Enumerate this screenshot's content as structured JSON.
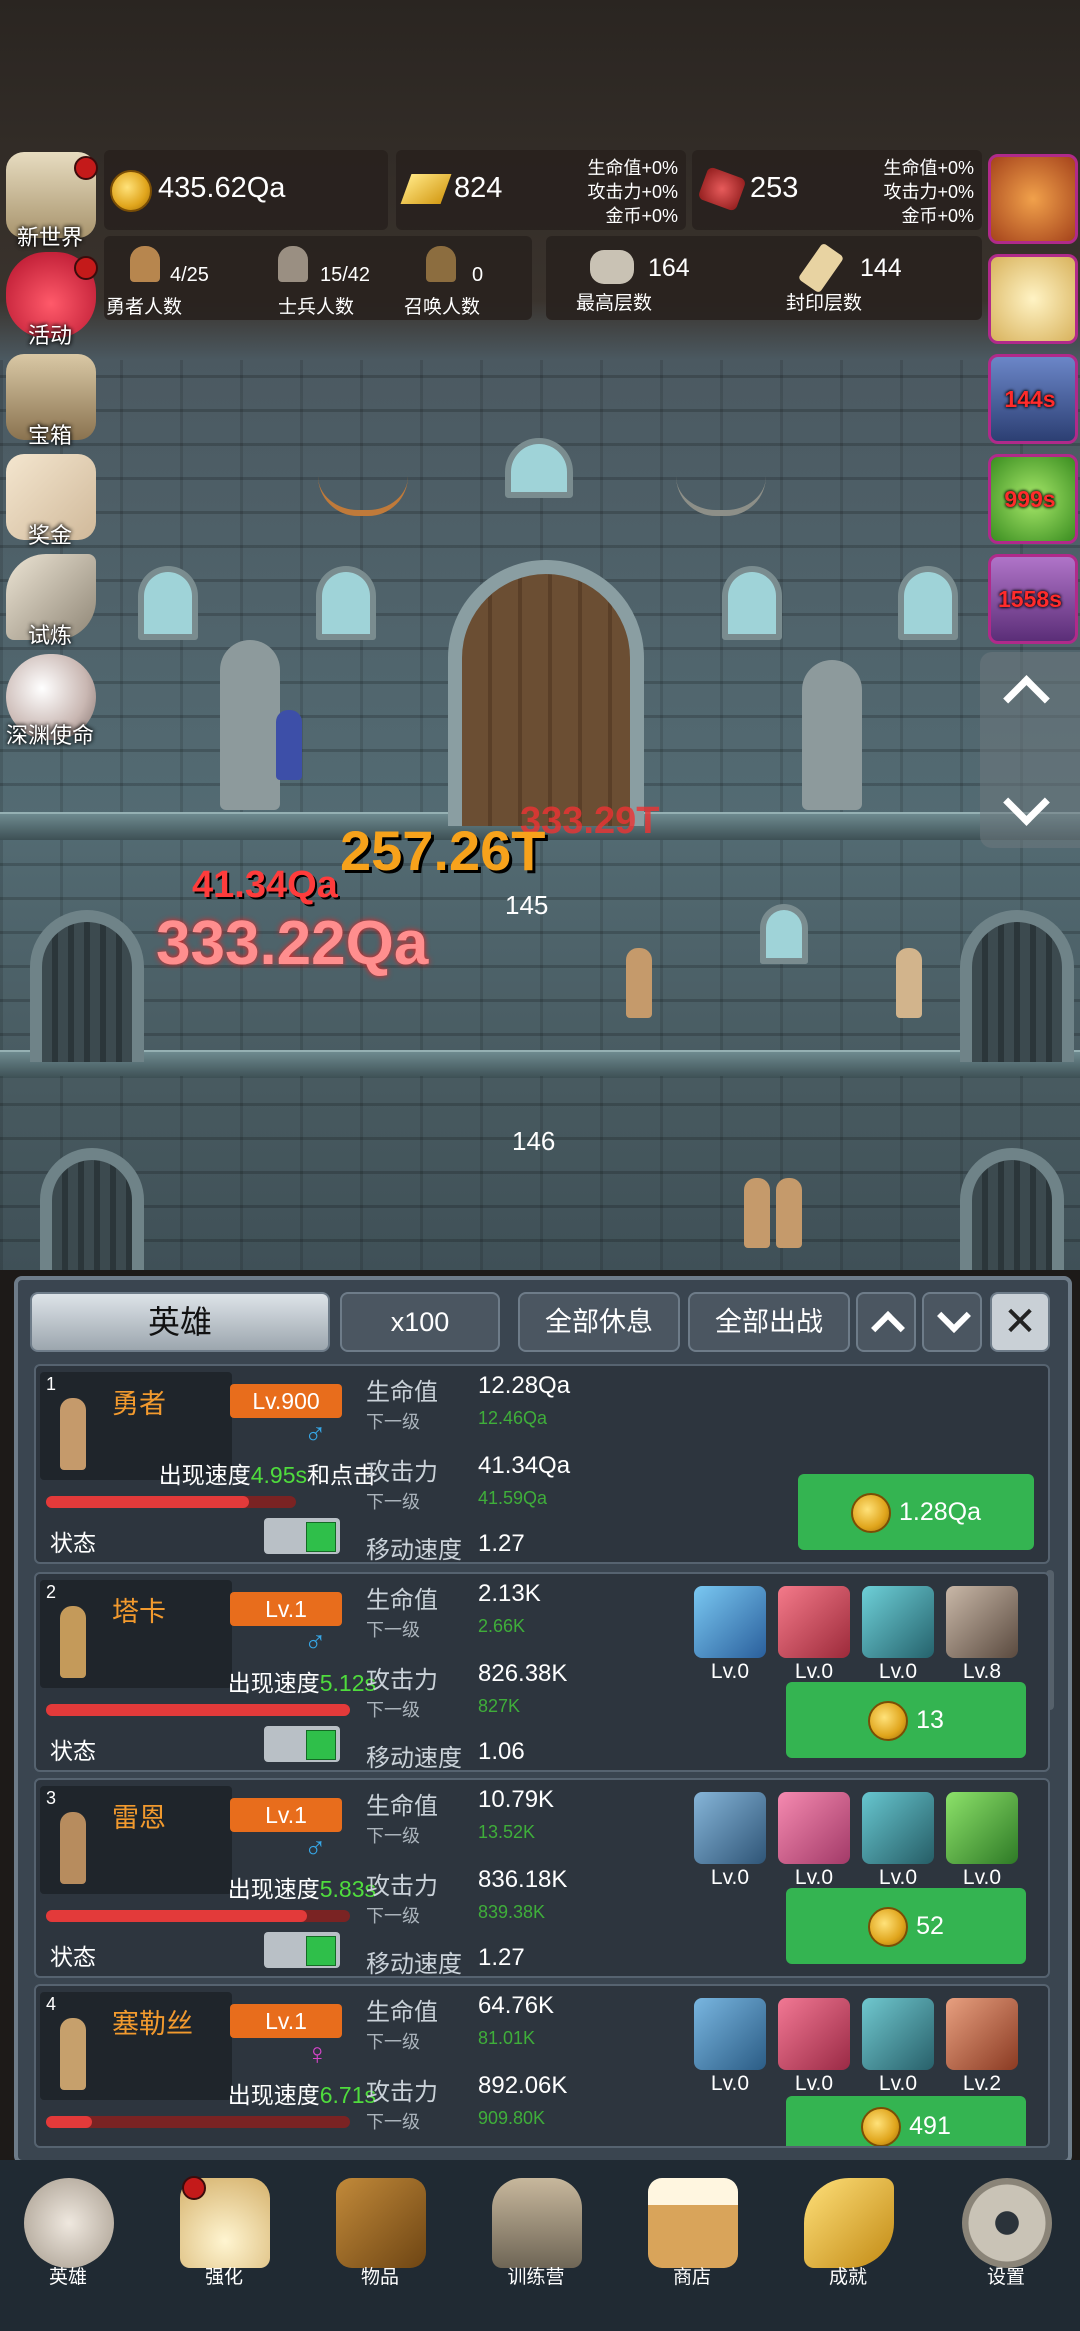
{
  "resources": {
    "gold": "435.62Qa",
    "gold_bar": "824",
    "gold_bar_bonus": [
      "生命值+0%",
      "攻击力+0%",
      "金币+0%"
    ],
    "gem": "253",
    "gem_bonus": [
      "生命值+0%",
      "攻击力+0%",
      "金币+0%"
    ]
  },
  "counts": {
    "heroes_value": "4/25",
    "heroes_label": "勇者人数",
    "soldiers_value": "15/42",
    "soldiers_label": "士兵人数",
    "summon_value": "0",
    "summon_label": "召唤人数",
    "max_floor_value": "164",
    "max_floor_label": "最高层数",
    "seal_floor_value": "144",
    "seal_floor_label": "封印层数"
  },
  "side_menu": [
    "新世界",
    "活动",
    "宝箱",
    "奖金",
    "试炼",
    "深渊使命"
  ],
  "right_timers": [
    "144s",
    "999s",
    "1558s"
  ],
  "scene": {
    "floor_a": "145",
    "floor_b": "146",
    "damage": [
      "257.26T",
      "41.34Qa",
      "333.22Qa",
      "333.29T"
    ]
  },
  "panel": {
    "tab_heroes": "英雄",
    "multiplier": "x100",
    "rest_all": "全部休息",
    "fight_all": "全部出战"
  },
  "heroes": [
    {
      "index": "1",
      "name": "勇者",
      "level": "Lv.900",
      "speed_prefix": "出现速度",
      "speed": "4.95s",
      "speed_suffix": "和点击",
      "hp_label": "生命值",
      "hp": "12.28Qa",
      "next_label": "下一级",
      "hp_next": "12.46Qa",
      "atk_label": "攻击力",
      "atk": "41.34Qa",
      "atk_next": "41.59Qa",
      "move_label": "移动速度",
      "move": "1.27",
      "status_label": "状态",
      "cost": "1.28Qa",
      "hp_ratio": 0.81
    },
    {
      "index": "2",
      "name": "塔卡",
      "level": "Lv.1",
      "speed_prefix": "出现速度",
      "speed": "5.12s",
      "hp_label": "生命值",
      "hp": "2.13K",
      "next_label": "下一级",
      "hp_next": "2.66K",
      "atk_label": "攻击力",
      "atk": "826.38K",
      "atk_next": "827K",
      "move_label": "移动速度",
      "move": "1.06",
      "status_label": "状态",
      "cost": "13",
      "skills": [
        "Lv.0",
        "Lv.0",
        "Lv.0",
        "Lv.8"
      ],
      "hp_ratio": 1.0
    },
    {
      "index": "3",
      "name": "雷恩",
      "level": "Lv.1",
      "speed_prefix": "出现速度",
      "speed": "5.83s",
      "hp_label": "生命值",
      "hp": "10.79K",
      "next_label": "下一级",
      "hp_next": "13.52K",
      "atk_label": "攻击力",
      "atk": "836.18K",
      "atk_next": "839.38K",
      "move_label": "移动速度",
      "move": "1.27",
      "status_label": "状态",
      "cost": "52",
      "skills": [
        "Lv.0",
        "Lv.0",
        "Lv.0",
        "Lv.0"
      ],
      "hp_ratio": 0.86
    },
    {
      "index": "4",
      "name": "塞勒丝",
      "level": "Lv.1",
      "speed_prefix": "出现速度",
      "speed": "6.71s",
      "hp_label": "生命值",
      "hp": "64.76K",
      "next_label": "下一级",
      "hp_next": "81.01K",
      "atk_label": "攻击力",
      "atk": "892.06K",
      "atk_next": "909.80K",
      "cost": "491",
      "skills": [
        "Lv.0",
        "Lv.0",
        "Lv.0",
        "Lv.2"
      ],
      "hp_ratio": 0.15
    }
  ],
  "nav": [
    "英雄",
    "强化",
    "物品",
    "训练营",
    "商店",
    "成就",
    "设置"
  ]
}
